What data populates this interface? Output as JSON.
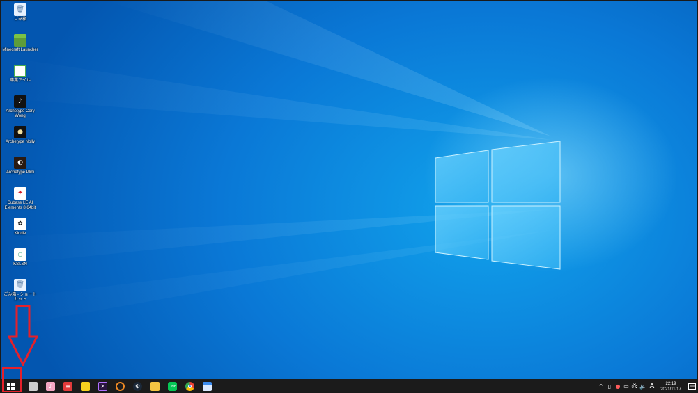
{
  "desktop": {
    "icons": [
      {
        "label": "ごみ箱",
        "icon": "recycle-bin-icon"
      },
      {
        "label": "Minecraft Launcher",
        "icon": "minecraft-icon"
      },
      {
        "label": "卒業アイル",
        "icon": "app-icon"
      },
      {
        "label": "Archetype Cory Wong",
        "icon": "archetype-cory-wong-icon"
      },
      {
        "label": "Archetype Nolly",
        "icon": "archetype-nolly-icon"
      },
      {
        "label": "Archetype Plini",
        "icon": "archetype-plini-icon"
      },
      {
        "label": "Cubase LE AI Elements 8 64bit",
        "icon": "cubase-icon"
      },
      {
        "label": "Kindle",
        "icon": "kindle-icon"
      },
      {
        "label": "KSLSN",
        "icon": "file-icon"
      },
      {
        "label": "ごみ箱 - ショートカット",
        "icon": "recycle-bin-shortcut-icon"
      }
    ]
  },
  "taskbar": {
    "apps": [
      {
        "name": "files-app-icon",
        "color": "#cfcfcf"
      },
      {
        "name": "itunes-icon",
        "color": "#f4a7c3"
      },
      {
        "name": "red-app-icon",
        "color": "#e23b3b"
      },
      {
        "name": "sticky-notes-icon",
        "color": "#f7d21e"
      },
      {
        "name": "media-player-icon",
        "color": "#6b2fa3"
      },
      {
        "name": "orange-app-icon",
        "color": "#f08a24"
      },
      {
        "name": "steam-icon",
        "color": "#1b2838"
      },
      {
        "name": "file-explorer-icon",
        "color": "#f5c542"
      },
      {
        "name": "line-icon",
        "color": "#06c755"
      },
      {
        "name": "chrome-icon",
        "color": "#4285f4"
      },
      {
        "name": "blue-window-app-icon",
        "color": "#3b8cf0"
      }
    ],
    "ime": "A",
    "clock_time": "22:19",
    "clock_date": "2021/11/17"
  },
  "colors": {
    "accent_red": "#e5202a",
    "taskbar": "#1b1b1b"
  }
}
